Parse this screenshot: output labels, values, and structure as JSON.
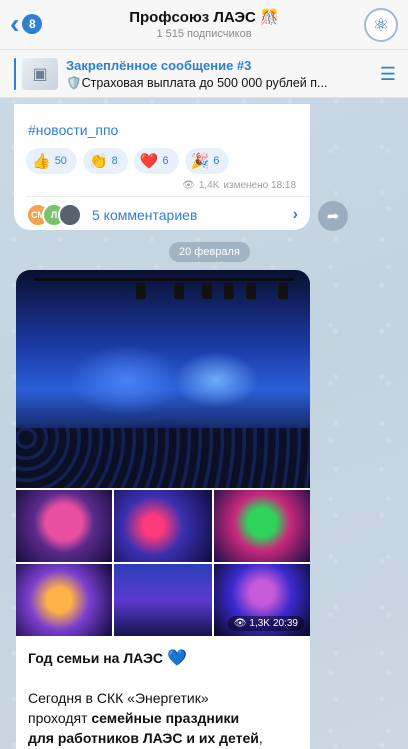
{
  "header": {
    "back_count": "8",
    "title": "Профсоюз ЛАЭС 🎊",
    "subtitle": "1 515 подписчиков"
  },
  "pinned": {
    "title": "Закреплённое сообщение #3",
    "text": "🛡️Страховая выплата до 500 000 рублей п..."
  },
  "message1": {
    "hashtag": "#новости_ппо",
    "reactions": [
      {
        "emoji": "👍",
        "count": "50"
      },
      {
        "emoji": "👏",
        "count": "8"
      },
      {
        "emoji": "❤️",
        "count": "6"
      },
      {
        "emoji": "🎉",
        "count": "6"
      }
    ],
    "views": "1,4K",
    "edited_time": "изменено 18:18",
    "commenter_avatars": [
      "СМ",
      "Л",
      ""
    ],
    "comments_label": "5 комментариев"
  },
  "date_separator": "20 февраля",
  "message2": {
    "views": "1,3K",
    "time": "20:39",
    "title": "Год семьи на ЛАЭС",
    "body_line1": "Сегодня в СКК «Энергетик»",
    "body_line2_prefix": "проходят ",
    "body_line2_bold": "семейные праздники",
    "body_line3_bold": "для работников ЛАЭС и их детей",
    "body_line3_suffix": ","
  }
}
